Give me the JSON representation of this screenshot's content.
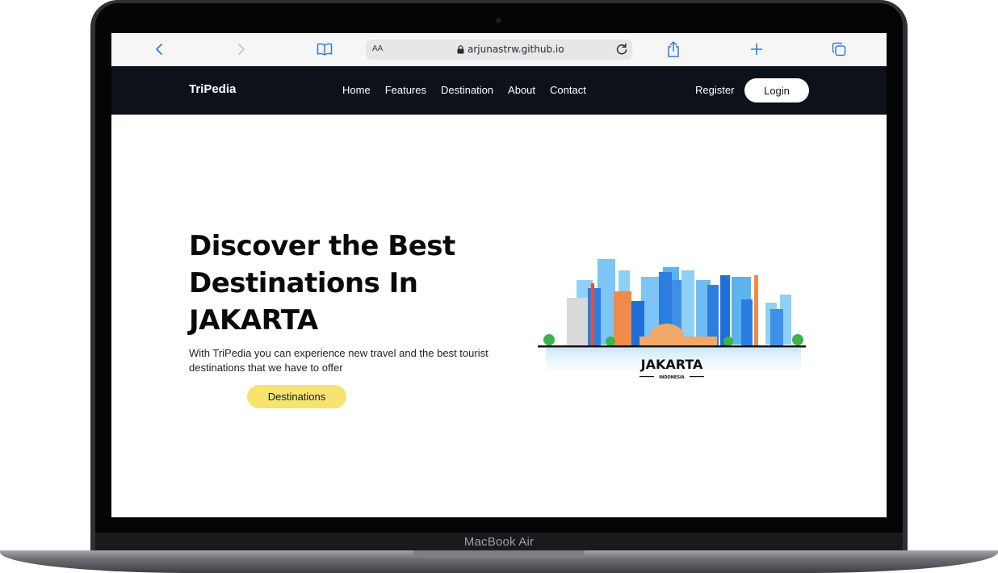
{
  "device": {
    "label": "MacBook Air"
  },
  "browser": {
    "reader_label": "AA",
    "url": "arjunastrw.github.io",
    "icons": [
      "back-icon",
      "forward-icon",
      "bookmarks-icon",
      "lock-icon",
      "reload-icon",
      "share-icon",
      "new-tab-icon",
      "tabs-icon"
    ]
  },
  "site": {
    "brand": "TriPedia",
    "nav": [
      "Home",
      "Features",
      "Destination",
      "About",
      "Contact"
    ],
    "register": "Register",
    "login": "Login"
  },
  "hero": {
    "title_lines": [
      "Discover the Best",
      "Destinations In",
      "JAKARTA"
    ],
    "description": "With TriPedia you can experience new travel and the best tourist destinations that we have to offer",
    "cta": "Destinations"
  },
  "illustration": {
    "city": "JAKARTA",
    "country": "INDONESIA"
  },
  "colors": {
    "nav_bg": "#0d1119",
    "cta_bg": "#f7e36f",
    "browser_accent": "#2f7ae5"
  }
}
